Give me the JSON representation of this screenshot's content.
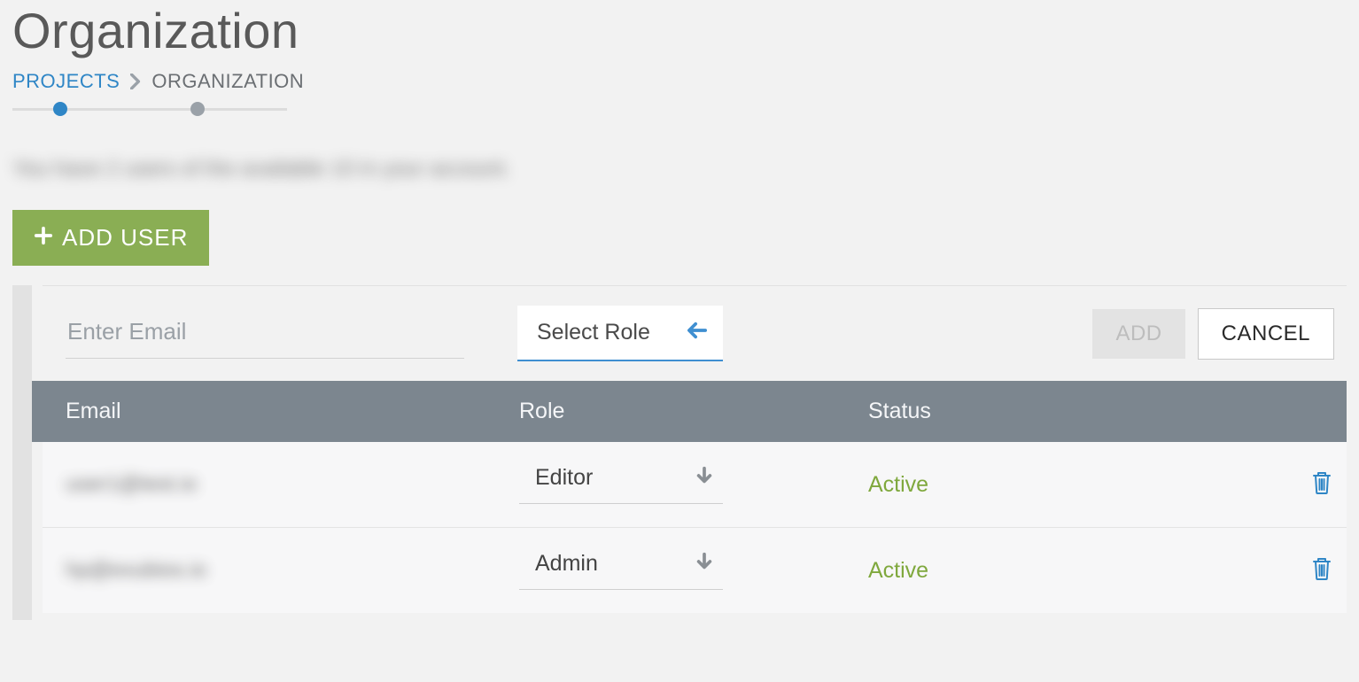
{
  "header": {
    "title": "Organization"
  },
  "breadcrumb": {
    "items": [
      {
        "label": "PROJECTS",
        "link": true
      },
      {
        "label": "ORGANIZATION",
        "link": false
      }
    ]
  },
  "info_text": "You have 2 users of the available 10 in your account.",
  "buttons": {
    "add_user": "ADD USER",
    "add": "ADD",
    "cancel": "CANCEL"
  },
  "form": {
    "email_placeholder": "Enter Email",
    "role_select_label": "Select Role"
  },
  "table": {
    "headers": {
      "email": "Email",
      "role": "Role",
      "status": "Status"
    },
    "rows": [
      {
        "email": "user1@test.io",
        "role": "Editor",
        "status": "Active"
      },
      {
        "email": "hp@exubios.io",
        "role": "Admin",
        "status": "Active"
      }
    ]
  },
  "colors": {
    "accent_blue": "#2f86c6",
    "accent_green": "#8aae54",
    "status_green": "#7fa83d",
    "header_gray": "#7c868f"
  }
}
